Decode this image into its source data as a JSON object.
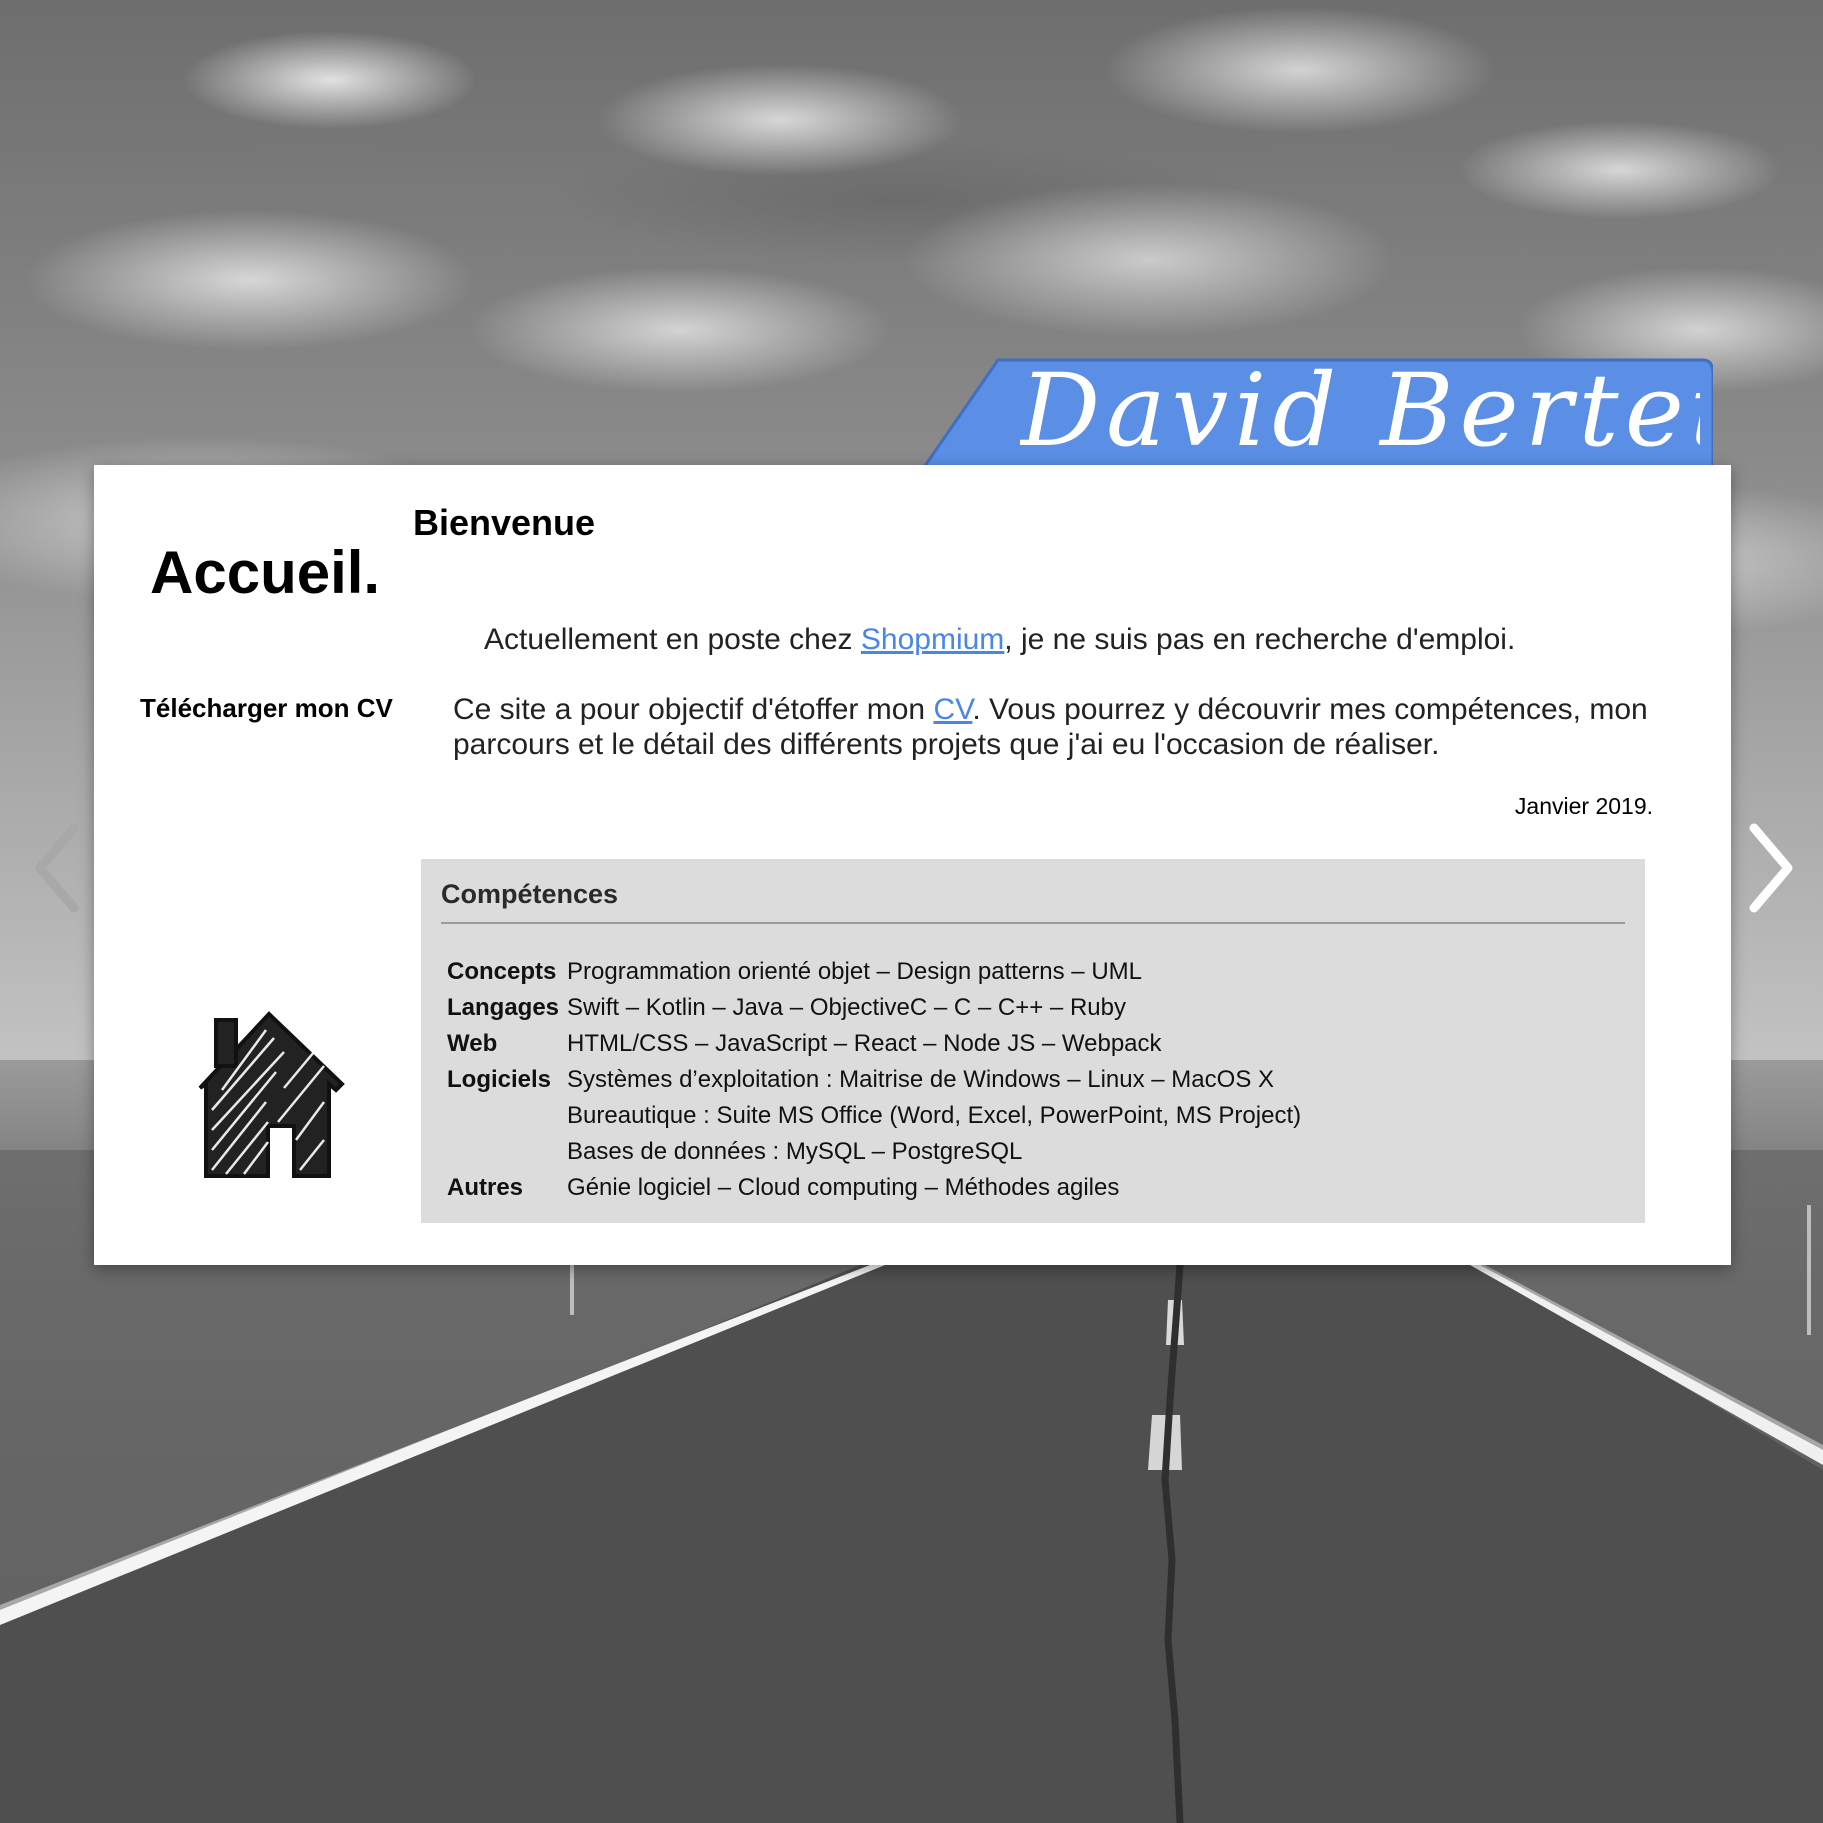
{
  "header": {
    "name": "David Bertet",
    "tab_color": "#5b8fe5"
  },
  "sidebar": {
    "page_title": "Accueil.",
    "cv_link": "Télécharger mon CV",
    "icon": "home-icon"
  },
  "main": {
    "title": "Bienvenue",
    "para1": {
      "before": "Actuellement en poste chez ",
      "link": "Shopmium",
      "after": ", je ne suis pas en recherche d'emploi."
    },
    "para2": {
      "before": "Ce site a pour objectif d'étoffer mon ",
      "link": "CV",
      "after": ". Vous pourrez y découvrir mes compétences, mon parcours et le détail des différents projets que j'ai eu l'occasion de réaliser."
    },
    "date": "Janvier 2019.",
    "link_color": "#4a86e8"
  },
  "skills": {
    "title": "Compétences",
    "rows": [
      {
        "category": "Concepts",
        "value": "Programmation orienté objet – Design patterns – UML"
      },
      {
        "category": "Langages",
        "value": "Swift – Kotlin – Java – ObjectiveC – C – C++ – Ruby"
      },
      {
        "category": "Web",
        "value": "HTML/CSS – JavaScript – React – Node JS – Webpack"
      },
      {
        "category": "Logiciels",
        "value": "Systèmes d’exploitation : Maitrise de Windows – Linux – MacOS X"
      },
      {
        "category": "",
        "value": "Bureautique : Suite MS Office (Word, Excel, PowerPoint, MS Project)"
      },
      {
        "category": "",
        "value": "Bases de données : MySQL – PostgreSQL"
      },
      {
        "category": "Autres",
        "value": "Génie logiciel – Cloud computing – Méthodes agiles"
      }
    ]
  },
  "navigation": {
    "prev_icon": "chevron-left-icon",
    "next_icon": "chevron-right-icon"
  }
}
